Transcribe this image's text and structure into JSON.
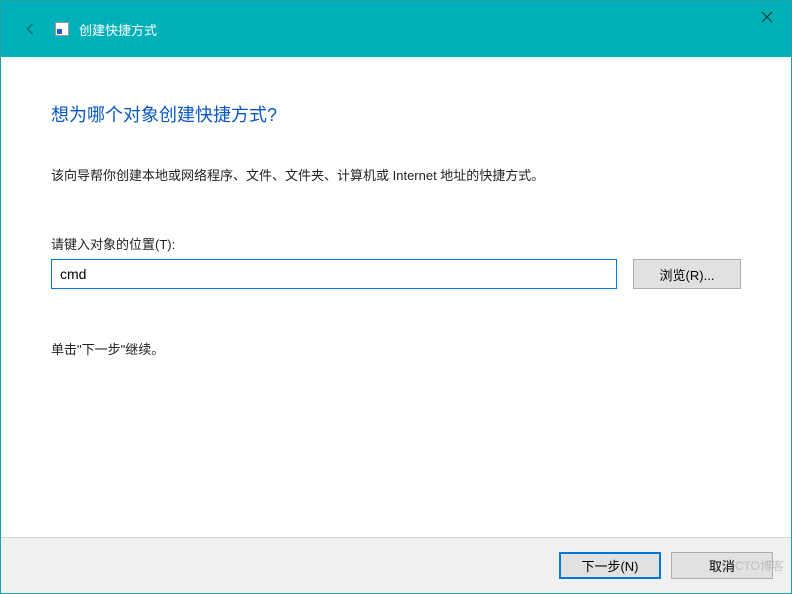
{
  "titlebar": {
    "title": "创建快捷方式"
  },
  "wizard": {
    "heading": "想为哪个对象创建快捷方式?",
    "description": "该向导帮你创建本地或网络程序、文件、文件夹、计算机或 Internet 地址的快捷方式。",
    "location_label": "请键入对象的位置(T):",
    "location_value": "cmd",
    "browse_label": "浏览(R)...",
    "hint": "单击\"下一步\"继续。"
  },
  "footer": {
    "next_label": "下一步(N)",
    "cancel_label": "取消"
  },
  "watermark": "@51CTO博客"
}
